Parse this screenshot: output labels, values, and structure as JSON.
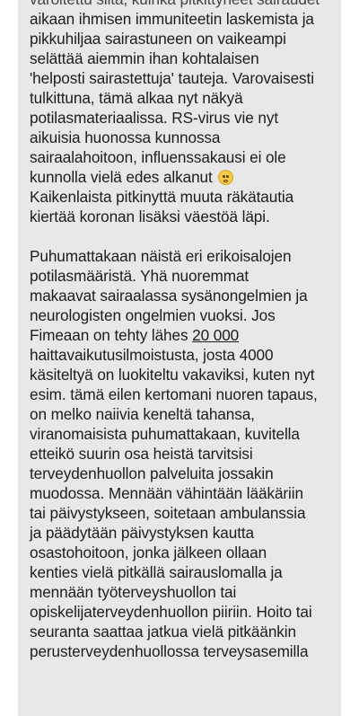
{
  "message": {
    "paragraph1": {
      "line0": "varoitettu siitä, kuinka pitkittyneet sairaudet",
      "line1": "aikaan ihmisen immuniteetin laskemista ja",
      "line2": "pikkuhiljaa sairastuneen on vaikeampi",
      "line3": "selättää aiemmin ihan kohtalaisen",
      "line4": "'helposti sairastettuja' tauteja. Varovaisesti",
      "line5": "tulkittuna, tämä alkaa nyt näkyä",
      "line6": "potilasmateriaalissa. RS-virus vie nyt",
      "line7": "aikuisia huonossa kunnossa",
      "line8": "sairaalahoitoon, influenssakausi ei ole",
      "line9": "kunnolla vielä edes alkanut",
      "line10": "Kaikenlaista pitkinyttä muuta räkätautia",
      "line11": "kiertää koronan lisäksi väestöä läpi."
    },
    "emoji_name": "flushed-face-emoji",
    "paragraph2": {
      "line1": "Puhumattakaan näistä eri erikoisalojen",
      "line2": "potilasmääristä. Yhä nuoremmat",
      "line3": "makaavat sairaalassa sysänongelmien ja",
      "line4": "neurologisten ongelmien vuoksi. Jos",
      "line5_prefix": "Fimeaan on tehty lähes ",
      "line5_link": "20 000",
      "line6": "haittavaikutusilmoistusta, josta 4000",
      "line7": "käsiteltyä on luokiteltu vakaviksi, kuten nyt",
      "line8": "esim. tämä eilen kertomani nuoren tapaus,",
      "line9": "on melko naiivia keneltä tahansa,",
      "line10": "viranomaisista puhumattakaan, kuvitella",
      "line11": "etteikö suurin osa heistä tarvitsisi",
      "line12": "terveydenhuollon palveluita jossakin",
      "line13": "muodossa. Mennään vähintään lääkäriin",
      "line14": "tai päivystykseen, soitetaan ambulanssia",
      "line15": "ja päädytään päivystyksen kautta",
      "line16": "osastohoitoon, jonka jälkeen ollaan",
      "line17": "kenties vielä pitkällä sairauslomalla ja",
      "line18": "mennään työterveyshuollon tai",
      "line19": "opiskelijaterveydenhuollon piiriin. Hoito tai",
      "line20": "seuranta saattaa jatkua vielä pitkäänkin",
      "line21": "perusterveydenhuollossa terveysasemilla"
    }
  },
  "colors": {
    "bubble_background": "#e8e8e8",
    "page_background": "#ffffff",
    "text": "#1d1d1d"
  }
}
